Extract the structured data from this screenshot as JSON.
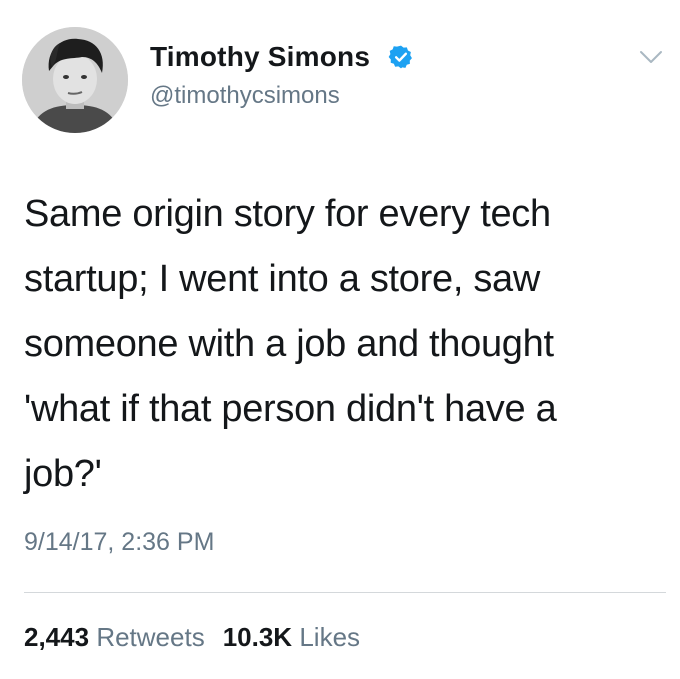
{
  "tweet": {
    "author": {
      "display_name": "Timothy Simons",
      "handle": "@timothycsimons",
      "verified": true,
      "avatar_icon": "profile-photo"
    },
    "menu_icon": "chevron-down-icon",
    "text": "Same origin story for every tech\nstartup; I went into a store, saw\nsomeone with a job and thought\n'what if that person didn't have a\njob?'",
    "timestamp": "9/14/17, 2:36 PM",
    "stats": {
      "retweets_count": "2,443",
      "retweets_label": "Retweets",
      "likes_count": "10.3K",
      "likes_label": "Likes"
    }
  },
  "colors": {
    "primary_text": "#14171a",
    "secondary_text": "#657786",
    "verified_badge": "#1da1f2",
    "divider": "#d4d8db"
  }
}
